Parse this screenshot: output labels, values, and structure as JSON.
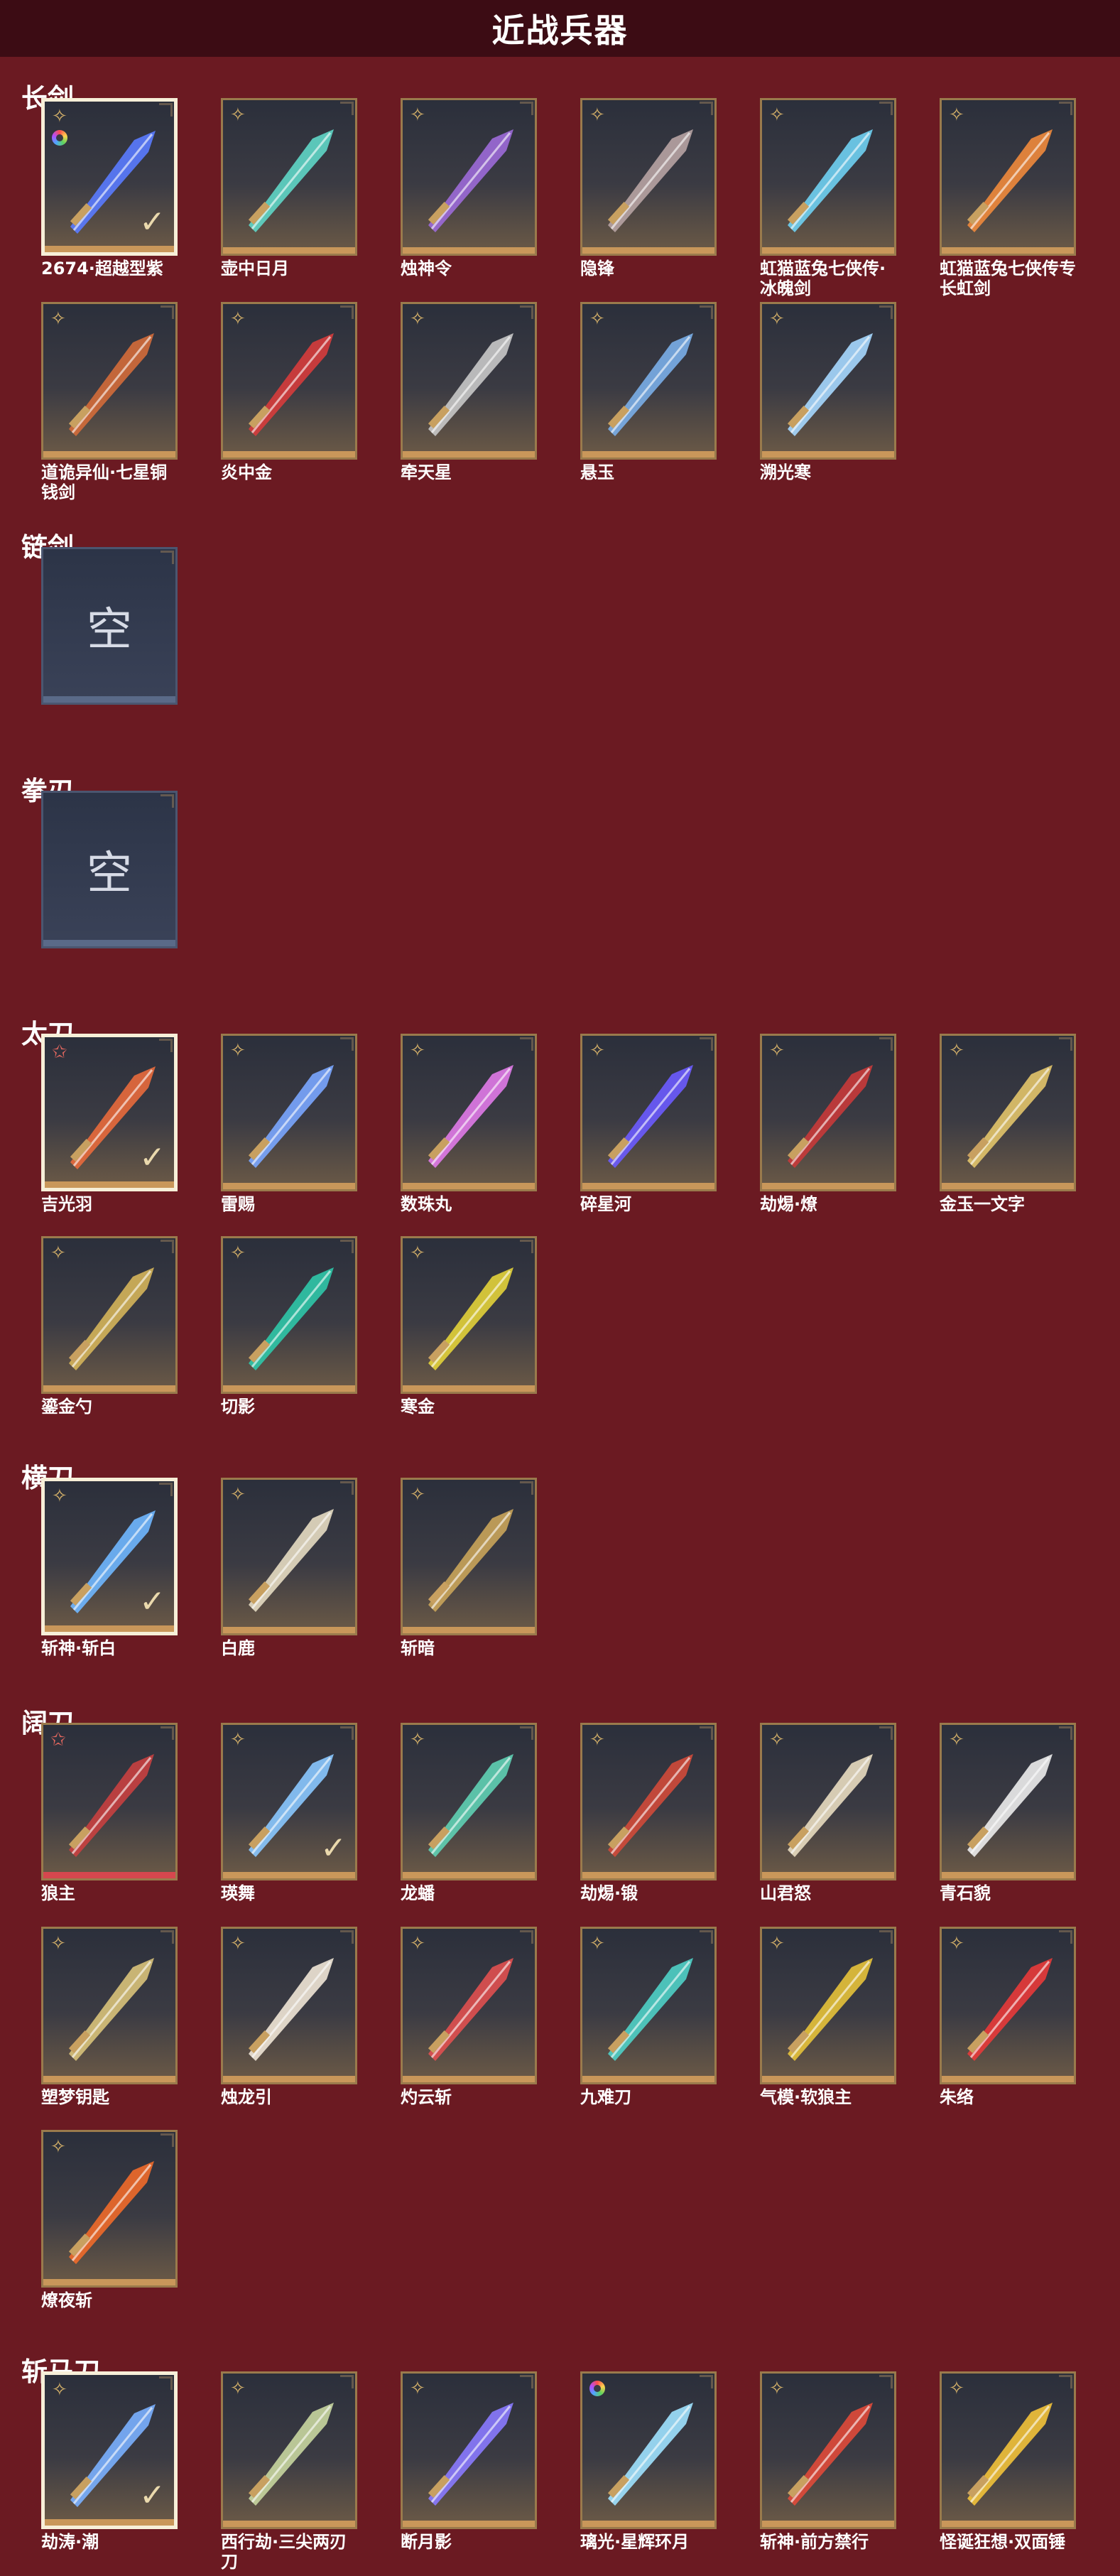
{
  "page_title": "近战兵器",
  "empty_label": "空",
  "sections": [
    {
      "title": "长剑",
      "items": [
        {
          "name": "2674·超越型紫",
          "rarity": "gold",
          "selected": true,
          "rainbow": true,
          "color": "#5a7bff"
        },
        {
          "name": "壶中日月",
          "rarity": "gold",
          "color": "#5fd6c6"
        },
        {
          "name": "烛神令",
          "rarity": "gold",
          "color": "#9c6ad8"
        },
        {
          "name": "隐锋",
          "rarity": "gold",
          "color": "#b7a3a3"
        },
        {
          "name": "虹猫蓝兔七侠传·冰魄剑",
          "rarity": "gold",
          "color": "#6fd0f2"
        },
        {
          "name": "虹猫蓝兔七侠传专长虹剑",
          "rarity": "gold",
          "color": "#f08a3c"
        },
        {
          "name": "道诡异仙·七星铜钱剑",
          "rarity": "gold",
          "color": "#d36b3a"
        },
        {
          "name": "炎中金",
          "rarity": "gold",
          "color": "#d63c3c"
        },
        {
          "name": "牵天星",
          "rarity": "gold",
          "color": "#c8c8c8"
        },
        {
          "name": "悬玉",
          "rarity": "gold",
          "color": "#7aaee8"
        },
        {
          "name": "溯光寒",
          "rarity": "gold",
          "color": "#a6d8ff"
        }
      ]
    },
    {
      "title": "链剑",
      "items": [
        {
          "name": "",
          "empty": true
        }
      ]
    },
    {
      "title": "拳刃",
      "items": [
        {
          "name": "",
          "empty": true
        }
      ]
    },
    {
      "title": "太刀",
      "items": [
        {
          "name": "吉光羽",
          "rarity": "star",
          "selected": true,
          "color": "#e86a3c"
        },
        {
          "name": "雷赐",
          "rarity": "gold",
          "color": "#7aa6ff"
        },
        {
          "name": "数珠丸",
          "rarity": "gold",
          "color": "#e07ae8"
        },
        {
          "name": "碎星河",
          "rarity": "gold",
          "color": "#6b5bff"
        },
        {
          "name": "劫焬·燎",
          "rarity": "gold",
          "color": "#c83a3a"
        },
        {
          "name": "金玉一文字",
          "rarity": "gold",
          "color": "#e2c46a"
        },
        {
          "name": "鎏金勺",
          "rarity": "gold",
          "color": "#d4b45a"
        },
        {
          "name": "切影",
          "rarity": "gold",
          "color": "#2fc7a8"
        },
        {
          "name": "寒金",
          "rarity": "gold",
          "color": "#e2d23a"
        }
      ]
    },
    {
      "title": "横刀",
      "items": [
        {
          "name": "斩神·斩白",
          "rarity": "gold",
          "selected": true,
          "color": "#6fb7ff"
        },
        {
          "name": "白鹿",
          "rarity": "gold",
          "color": "#e6dcc2"
        },
        {
          "name": "斩暗",
          "rarity": "gold",
          "color": "#c9a45a"
        }
      ]
    },
    {
      "title": "阔刀",
      "items": [
        {
          "name": "狼主",
          "rarity": "star",
          "red": true,
          "color": "#c84040"
        },
        {
          "name": "瑛舞",
          "rarity": "gold",
          "checked": true,
          "color": "#8ac8ff"
        },
        {
          "name": "龙蟠",
          "rarity": "gold",
          "color": "#5fd0b4"
        },
        {
          "name": "劫焬·锻",
          "rarity": "gold",
          "color": "#d04a3a"
        },
        {
          "name": "山君怒",
          "rarity": "gold",
          "color": "#e8dcc0"
        },
        {
          "name": "青石貌",
          "rarity": "gold",
          "color": "#ececec"
        },
        {
          "name": "塑梦钥匙",
          "rarity": "gold",
          "color": "#d8c27a"
        },
        {
          "name": "烛龙引",
          "rarity": "gold",
          "color": "#f0e6d6"
        },
        {
          "name": "灼云斩",
          "rarity": "gold",
          "color": "#e05050"
        },
        {
          "name": "九难刀",
          "rarity": "gold",
          "color": "#4fd0c6"
        },
        {
          "name": "气模·软狼主",
          "rarity": "gold",
          "color": "#e6c23a"
        },
        {
          "name": "朱络",
          "rarity": "gold",
          "color": "#e83a3a"
        },
        {
          "name": "燎夜斩",
          "rarity": "gold",
          "color": "#f06a2a"
        }
      ]
    },
    {
      "title": "斩马刀",
      "items": [
        {
          "name": "劫涛·潮",
          "rarity": "gold",
          "selected": true,
          "color": "#7ab0ff"
        },
        {
          "name": "西行劫·三尖两刃刀",
          "rarity": "gold",
          "color": "#c8d6a0"
        },
        {
          "name": "断月影",
          "rarity": "gold",
          "color": "#8a7aff"
        },
        {
          "name": "璃光·星辉环月",
          "rarity": "gold",
          "rainbowOnly": true,
          "color": "#9ee2ff"
        },
        {
          "name": "斩神·前方禁行",
          "rarity": "gold",
          "color": "#e04a3a"
        },
        {
          "name": "怪诞狂想·双面锤",
          "rarity": "gold",
          "color": "#f2c23a"
        }
      ]
    }
  ]
}
